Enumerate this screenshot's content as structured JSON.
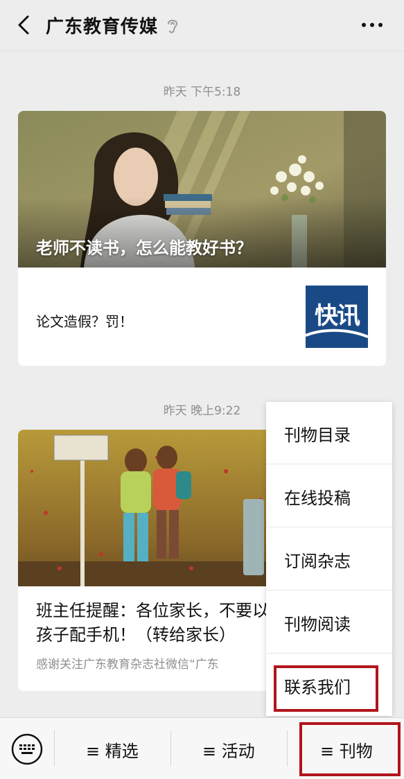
{
  "header": {
    "title": "广东教育传媒",
    "back_icon": "back-arrow-icon",
    "verified_icon": "ear-icon",
    "more_icon": "more-dots-icon"
  },
  "messages": [
    {
      "timestamp": "昨天 下午5:18",
      "hero_title": "老师不读书，怎么能教好书？",
      "sub_title": "论文造假？罚！",
      "thumb_text": "快讯"
    },
    {
      "timestamp": "昨天 晚上9:22",
      "headline": "班主任提醒：各位家长，不要以任何名义给孩子配手机！（转给家长）",
      "summary": "感谢关注广东教育杂志社微信“广东"
    }
  ],
  "popup_menu": {
    "items": [
      "刊物目录",
      "在线投稿",
      "订阅杂志",
      "刊物阅读",
      "联系我们"
    ]
  },
  "bottom_bar": {
    "keyboard_icon": "keyboard-icon",
    "tabs": [
      "≡ 精选",
      "≡ 活动",
      "≡ 刊物"
    ]
  },
  "colors": {
    "highlight": "#b0151b",
    "background": "#ededed",
    "thumb_blue": "#1a4a86"
  }
}
